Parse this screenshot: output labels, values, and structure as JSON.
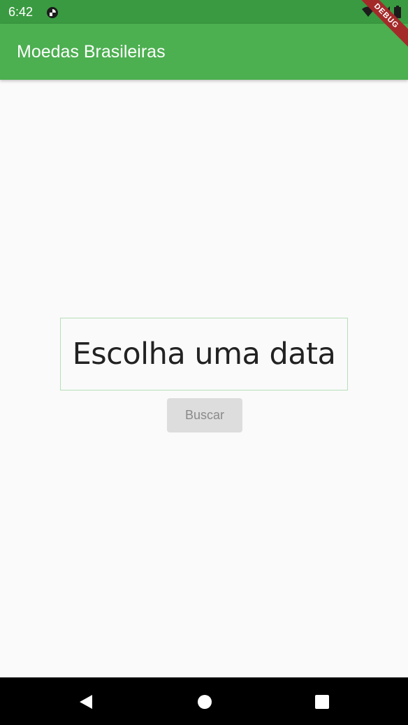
{
  "status_bar": {
    "time": "6:42",
    "background_color": "#3a9a41"
  },
  "app_bar": {
    "title": "Moedas Brasileiras",
    "background_color": "#4caf50"
  },
  "debug_banner": {
    "label": "DEBUG"
  },
  "main": {
    "date_picker_label": "Escolha uma data",
    "search_button_label": "Buscar"
  },
  "icons": {
    "status_app": "circle-status-icon",
    "wifi": "wifi-icon",
    "signal": "signal-icon",
    "battery": "battery-icon",
    "back": "back-triangle-icon",
    "home": "home-circle-icon",
    "recents": "recents-square-icon"
  }
}
